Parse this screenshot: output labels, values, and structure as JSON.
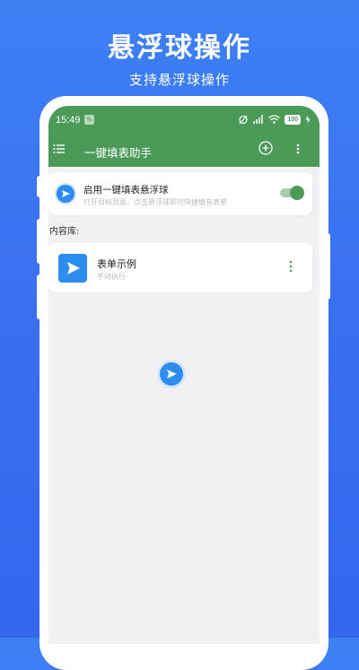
{
  "promo": {
    "title": "悬浮球操作",
    "subtitle": "支持悬浮球操作"
  },
  "status_bar": {
    "time": "15:49",
    "battery": "100"
  },
  "app_bar": {
    "title": "一键填表助手"
  },
  "float_setting": {
    "title": "启用一键填表悬浮球",
    "description": "打开目标页面，点击悬浮球即可快捷填充表单",
    "enabled": true
  },
  "content_library": {
    "label": "内容库:",
    "items": [
      {
        "title": "表单示例",
        "subtitle": "手动执行"
      }
    ]
  },
  "colors": {
    "background": "#3a6ef0",
    "app_bar": "#4b9a57",
    "accent_blue": "#2d8cf0",
    "toggle_on": "#4b9a57"
  }
}
